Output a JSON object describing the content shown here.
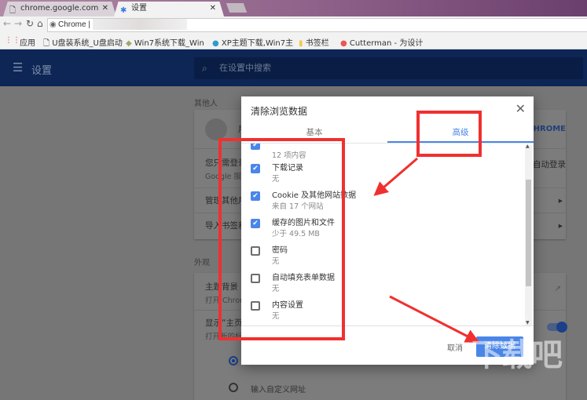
{
  "browser": {
    "tabs": [
      {
        "label": "chrome.google.com",
        "active": false
      },
      {
        "label": "设置",
        "active": true
      }
    ],
    "omnibox": {
      "scheme_label": "Chrome",
      "text": "c"
    },
    "bookmarks": [
      "应用",
      "U盘装系统_U盘启动",
      "Win7系统下载_Win",
      "XP主题下载,Win7主",
      "书签栏",
      "Cutterman - 为设计"
    ]
  },
  "settings": {
    "title": "设置",
    "search_placeholder": "在设置中搜索",
    "people": {
      "heading": "其他人",
      "user_initial": "用",
      "sync_button": "CHROME",
      "signin_line1": "您只需登录",
      "signin_line2": "Google 服务",
      "signin_right": "绘自动登录",
      "manage": "管理其他用户",
      "import": "导入书签和设置"
    },
    "appearance": {
      "heading": "外观",
      "theme": "主题背景",
      "theme_sub": "打开 Chrome",
      "home": "显示“主页”按钮",
      "home_sub": "打开新的标签页",
      "custom_url": "输入自定义网址",
      "home_toggle": true
    }
  },
  "dialog": {
    "title": "清除浏览数据",
    "tabs": [
      {
        "label": "基本",
        "active": false
      },
      {
        "label": "高级",
        "active": true
      }
    ],
    "items": [
      {
        "label": "",
        "sub": "12 项内容",
        "checked": true
      },
      {
        "label": "下载记录",
        "sub": "无",
        "checked": true
      },
      {
        "label": "Cookie 及其他网站数据",
        "sub": "来自 17 个网站",
        "checked": true
      },
      {
        "label": "缓存的图片和文件",
        "sub": "少于 49.5 MB",
        "checked": true
      },
      {
        "label": "密码",
        "sub": "无",
        "checked": false
      },
      {
        "label": "自动填充表单数据",
        "sub": "无",
        "checked": false
      },
      {
        "label": "内容设置",
        "sub": "无",
        "checked": false
      }
    ],
    "cancel": "取消",
    "confirm": "清除数据"
  },
  "colors": {
    "accent": "#4a86e8",
    "annotation": "#f0302f",
    "header": "#0d2656"
  },
  "watermark": {
    "text": "下载吧",
    "url": "www.xiazaiba.com"
  }
}
